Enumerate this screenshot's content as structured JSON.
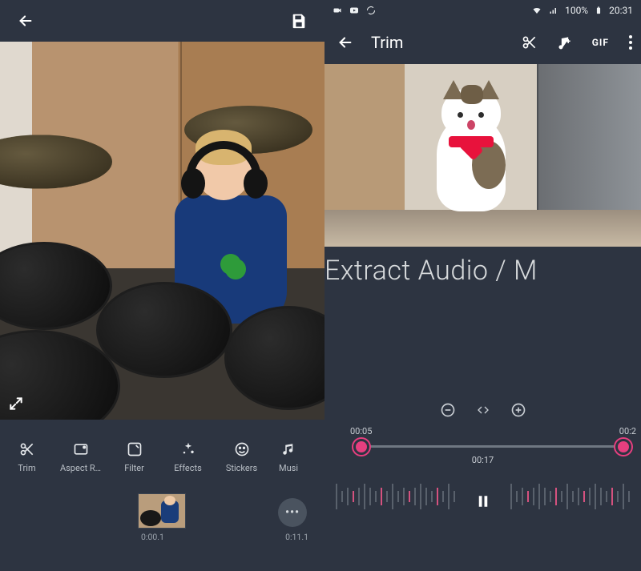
{
  "left": {
    "tools": [
      {
        "label": "Trim",
        "icon": "scissors-icon"
      },
      {
        "label": "Aspect R…",
        "icon": "aspect-icon"
      },
      {
        "label": "Filter",
        "icon": "filter-icon"
      },
      {
        "label": "Effects",
        "icon": "effects-icon"
      },
      {
        "label": "Stickers",
        "icon": "sticker-icon"
      },
      {
        "label": "Musi",
        "icon": "music-icon"
      }
    ],
    "timeline": {
      "start": "0:00.1",
      "end": "0:11.1",
      "more": "•••"
    }
  },
  "right": {
    "status": {
      "battery": "100%",
      "clock": "20:31"
    },
    "title": "Trim",
    "actions": {
      "gif": "GIF"
    },
    "caption": "Extract Audio / M",
    "range": {
      "start": "00:05",
      "cursor": "00:17",
      "end": "00:2"
    }
  }
}
